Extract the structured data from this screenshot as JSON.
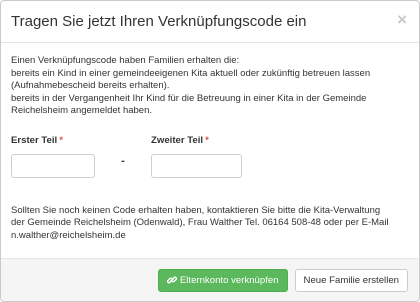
{
  "modal": {
    "title": "Tragen Sie jetzt Ihren Verknüpfungscode ein",
    "close_symbol": "×"
  },
  "intro": {
    "line1": "Einen Verknüpfungscode haben Familien erhalten die:",
    "line2": "bereits ein Kind in einer gemeindeeigenen Kita aktuell oder zukünftig betreuen lassen",
    "line3": "(Aufnahmebescheid bereits erhalten).",
    "line4": "bereits in der Vergangenheit Ihr Kind für die Betreuung in einer Kita in der Gemeinde",
    "line5": "Reichelsheim angemeldet haben."
  },
  "form": {
    "first_label": "Erster Teil",
    "second_label": "Zweiter Teil",
    "required_marker": "*",
    "separator": "-",
    "first_value": "",
    "second_value": ""
  },
  "note": {
    "line1": "Sollten Sie noch keinen Code erhalten haben, kontaktieren Sie bitte die Kita-Verwaltung",
    "line2": "der Gemeinde Reichelsheim (Odenwald), Frau Walther Tel. 06164 508-48 oder per E-Mail",
    "line3": "n.walther@reichelsheim.de"
  },
  "footer": {
    "link_button_label": "Elternkonto verknüpfen",
    "link_button_icon": "link-icon",
    "new_family_button_label": "Neue Familie erstellen"
  },
  "colors": {
    "success": "#5cb85c",
    "required": "#d9534f",
    "footer_bg": "#f5f5f5"
  }
}
